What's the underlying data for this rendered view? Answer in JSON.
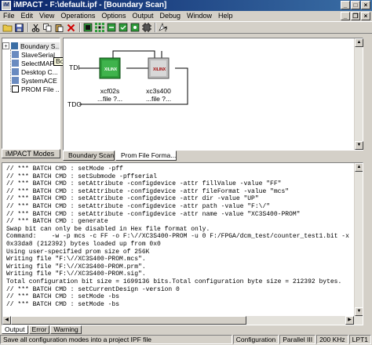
{
  "window": {
    "app_icon_text": "iM",
    "title": "iMPACT - F:\\default.ipf - [Boundary Scan]"
  },
  "menu": [
    "File",
    "Edit",
    "View",
    "Operations",
    "Options",
    "Output",
    "Debug",
    "Window",
    "Help"
  ],
  "modes": {
    "items": [
      {
        "label": "Boundary S..."
      },
      {
        "label": "SlaveSerial"
      },
      {
        "label": "SelectMAP"
      },
      {
        "label": "Desktop C..."
      },
      {
        "label": "SystemACE"
      },
      {
        "label": "PROM File ..."
      }
    ],
    "tab_label": "iMPACT Modes",
    "tooltip": "Boundary Scan"
  },
  "chain": {
    "tdi_label": "TDI",
    "tdo_label": "TDO",
    "devices": [
      {
        "name": "xcf02s",
        "file": "...file ?...",
        "logo": "XILINX",
        "color": "#2e9b3a"
      },
      {
        "name": "xc3s400",
        "file": "...file ?...",
        "logo": "XILINX",
        "color": "#bdbdbd"
      }
    ]
  },
  "doc_tabs": [
    {
      "label": "Boundary Scan"
    },
    {
      "label": "Prom File Forma..."
    }
  ],
  "console": {
    "lines": [
      "// *** BATCH CMD : setMode -pff",
      "// *** BATCH CMD : setSubmode -pffserial",
      "// *** BATCH CMD : setAttribute -configdevice -attr fillValue -value \"FF\"",
      "// *** BATCH CMD : setAttribute -configdevice -attr fileFormat -value \"mcs\"",
      "// *** BATCH CMD : setAttribute -configdevice -attr dir -value \"UP\"",
      "// *** BATCH CMD : setAttribute -configdevice -attr path -value \"F:\\/\"",
      "// *** BATCH CMD : setAttribute -configdevice -attr name -value \"XC3S400-PROM\"",
      "// *** BATCH CMD : generate",
      "Swap bit can only be disabled in Hex file format only.",
      "Command:    -w -p mcs -c FF -o F:\\//XC3S400-PROM -u 0 F:/FPGA/dcm_test/counter_test1.bit -x",
      "0x33da8 (212392) bytes loaded up from 0x0",
      "Using user-specified prom size of 256K",
      "Writing file \"F:\\//XC3S400-PROM.mcs\".",
      "Writing file \"F:\\//XC3S400-PROM.prm\".",
      "Writing file \"F:\\//XC3S400-PROM.sig\".",
      "Total configuration bit size = 1699136 bits.Total configuration byte size = 212392 bytes.",
      "// *** BATCH CMD : setCurrentDesign -version 0",
      "// *** BATCH CMD : setMode -bs",
      "// *** BATCH CMD : setMode -bs"
    ]
  },
  "console_tabs": [
    "Output",
    "Error",
    "Warning"
  ],
  "status": {
    "message": "Save all configuration modes into a project IPF file",
    "mode": "Configuration",
    "cable": "Parallel III",
    "speed": "200 KHz",
    "port": "LPT1"
  }
}
